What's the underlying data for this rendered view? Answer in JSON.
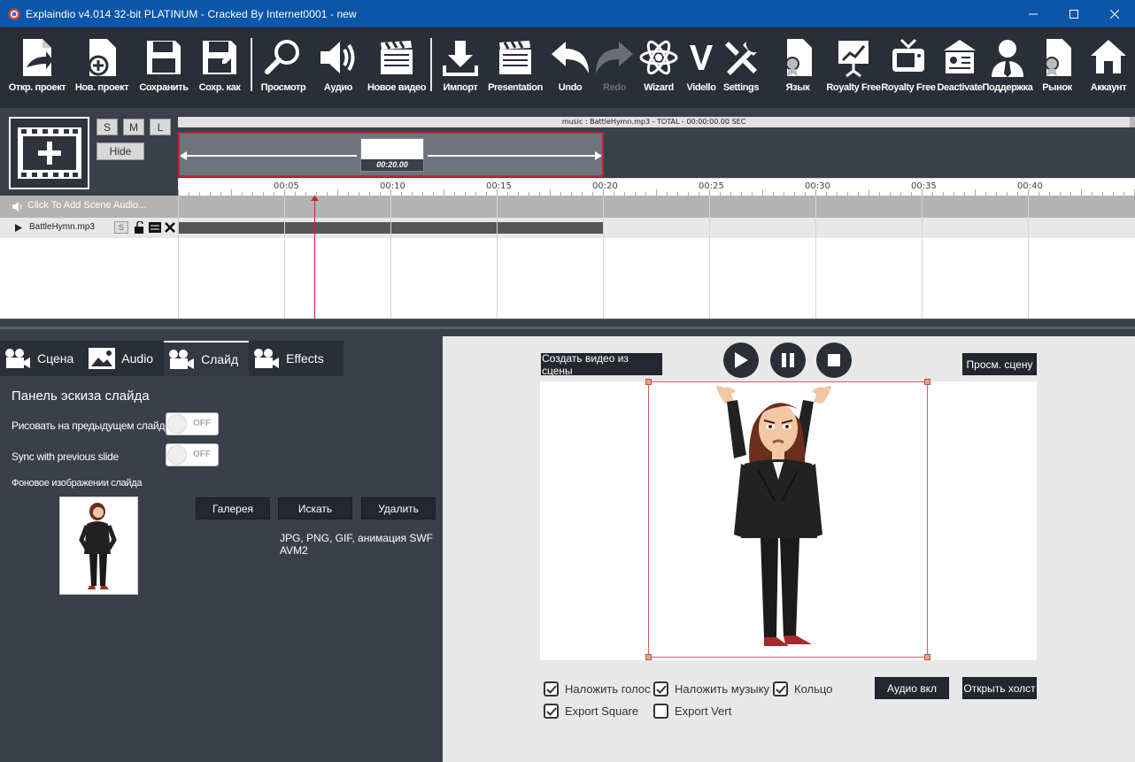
{
  "window": {
    "title": "Explaindio v4.014 32-bit PLATINUM - Cracked By Internet0001 - new"
  },
  "toolbar": {
    "open": "Откр. проект",
    "new": "Нов. проект",
    "save": "Сохранить",
    "save_as": "Сохр. как",
    "preview": "Просмотр",
    "audio": "Аудио",
    "new_video": "Новое видео",
    "import": "Импорт",
    "presentation": "Presentation",
    "undo": "Undo",
    "redo": "Redo",
    "wizard": "Wizard",
    "vidello": "Vidello",
    "settings": "Settings",
    "language": "Язык",
    "royalty1": "Royalty Free",
    "royalty2": "Royalty Free",
    "deactivate": "Deactivate",
    "support": "Поддержка",
    "market": "Рынок",
    "account": "Аккаунт"
  },
  "timeline": {
    "size_s": "S",
    "size_m": "M",
    "size_l": "L",
    "hide": "Hide",
    "music_info": "music : BattleHymn.mp3  -  TOTAL  -  00:00:00.00 SEC",
    "scene_duration": "00:20.00",
    "ruler": [
      "00:05",
      "00:10",
      "00:15",
      "00:20",
      "00:25",
      "00:30",
      "00:35",
      "00:40"
    ],
    "add_scene_audio": "Click To Add Scene Audio...",
    "track_name": "BattleHymn.mp3",
    "track_s": "S"
  },
  "tabs": {
    "scene": "Сцена",
    "audio": "Audio",
    "slide": "Слайд",
    "effects": "Effects"
  },
  "slide_panel": {
    "title": "Панель эскиза слайда",
    "draw_prev": "Рисовать на предыдущем слайде",
    "sync_prev": "Sync with previous slide",
    "toggle_off": "OFF",
    "bg_image": "Фоновое изображении слайда",
    "gallery": "Галерея",
    "search": "Искать",
    "delete": "Удалить",
    "formats": "JPG, PNG, GIF, анимация SWF AVM2"
  },
  "preview": {
    "create_video": "Создать видео из сцены",
    "view_scene": "Просм. сцену",
    "overlay_voice": "Наложить голос",
    "overlay_music": "Наложить музыку",
    "loop": "Кольцо",
    "export_square": "Export Square",
    "export_vert": "Export Vert",
    "audio_on": "Аудио вкл",
    "open_canvas": "Открыть холст"
  },
  "colors": {
    "title_bar": "#0b56a8",
    "toolbar_bg": "#2a2e37",
    "accent_red": "#c1272d"
  }
}
